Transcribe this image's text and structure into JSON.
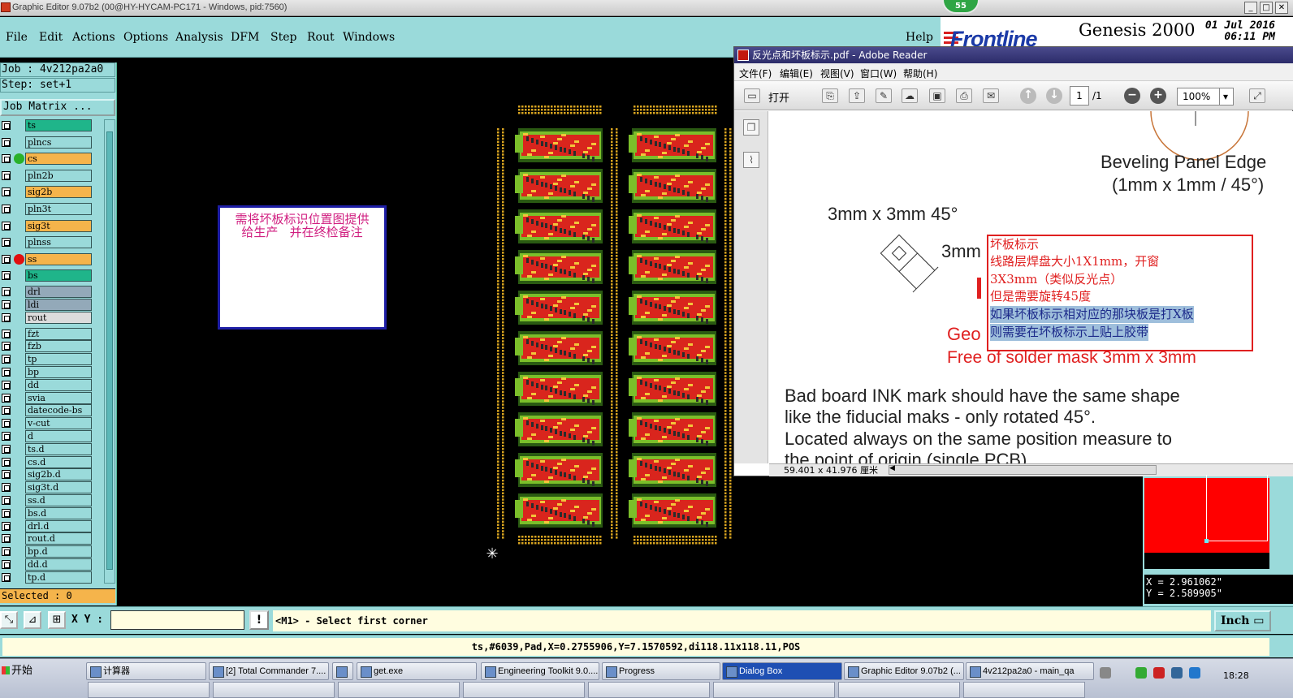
{
  "window": {
    "title": "Graphic Editor 9.07b2 (00@HY-HYCAM-PC171 - Windows, pid:7560)",
    "badge": "55",
    "min_label": "_",
    "max_label": "□",
    "close_label": "✕"
  },
  "menu": {
    "items": [
      "File",
      "Edit",
      "Actions",
      "Options",
      "Analysis",
      "DFM",
      "Step",
      "Rout",
      "Windows"
    ],
    "help": "Help"
  },
  "brand": {
    "logo": "Frontline",
    "product": "Genesis 2000",
    "date": "01 Jul 2016",
    "time": "06:11 PM"
  },
  "left": {
    "job": "Job : 4v212pa2a0",
    "step": "Step: set+1",
    "matrix": "Job Matrix ...",
    "selected": "Selected : 0",
    "layers": [
      {
        "name": "ts",
        "color": "#1fb58a",
        "dot": ""
      },
      {
        "name": "plncs",
        "color": "#9adada",
        "dot": ""
      },
      {
        "name": "cs",
        "color": "#f5b44b",
        "dot": "#29b129"
      },
      {
        "name": "pln2b",
        "color": "#9adada",
        "dot": ""
      },
      {
        "name": "sig2b",
        "color": "#f5b44b",
        "dot": ""
      },
      {
        "name": "pln3t",
        "color": "#9adada",
        "dot": ""
      },
      {
        "name": "sig3t",
        "color": "#f5b44b",
        "dot": ""
      },
      {
        "name": "plnss",
        "color": "#9adada",
        "dot": ""
      },
      {
        "name": "ss",
        "color": "#f5b44b",
        "dot": "#e01010"
      },
      {
        "name": "bs",
        "color": "#1fb58a",
        "dot": ""
      },
      {
        "name": "drl",
        "color": "#93a9b9",
        "dot": ""
      },
      {
        "name": "ldi",
        "color": "#93a9b9",
        "dot": ""
      },
      {
        "name": "rout",
        "color": "#dcdcdc",
        "dot": ""
      },
      {
        "name": "fzt",
        "color": "#9adada",
        "dot": ""
      },
      {
        "name": "fzb",
        "color": "#9adada",
        "dot": ""
      },
      {
        "name": "tp",
        "color": "#9adada",
        "dot": ""
      },
      {
        "name": "bp",
        "color": "#9adada",
        "dot": ""
      },
      {
        "name": "dd",
        "color": "#9adada",
        "dot": ""
      },
      {
        "name": "svia",
        "color": "#9adada",
        "dot": ""
      },
      {
        "name": "datecode-bs",
        "color": "#9adada",
        "dot": ""
      },
      {
        "name": "v-cut",
        "color": "#9adada",
        "dot": ""
      },
      {
        "name": "d",
        "color": "#9adada",
        "dot": ""
      },
      {
        "name": "ts.d",
        "color": "#9adada",
        "dot": ""
      },
      {
        "name": "cs.d",
        "color": "#9adada",
        "dot": ""
      },
      {
        "name": "sig2b.d",
        "color": "#9adada",
        "dot": ""
      },
      {
        "name": "sig3t.d",
        "color": "#9adada",
        "dot": ""
      },
      {
        "name": "ss.d",
        "color": "#9adada",
        "dot": ""
      },
      {
        "name": "bs.d",
        "color": "#9adada",
        "dot": ""
      },
      {
        "name": "drl.d",
        "color": "#9adada",
        "dot": ""
      },
      {
        "name": "rout.d",
        "color": "#9adada",
        "dot": ""
      },
      {
        "name": "bp.d",
        "color": "#9adada",
        "dot": ""
      },
      {
        "name": "dd.d",
        "color": "#9adada",
        "dot": ""
      },
      {
        "name": "tp.d",
        "color": "#9adada",
        "dot": ""
      }
    ]
  },
  "canvas": {
    "note": "需将坏板标识位置图提供\n给生产   并在终检备注",
    "crosshair": "✳"
  },
  "reader": {
    "title": "反光点和坏板标示.pdf - Adobe Reader",
    "menu": [
      "文件(F)",
      "编辑(E)",
      "视图(V)",
      "窗口(W)",
      "帮助(H)"
    ],
    "open": "打开",
    "page": "1",
    "page_total": "/1",
    "zoom": "100%",
    "status": "59.401 x 41.976 厘米",
    "pdf": {
      "bevel_title": "Beveling Panel Edge",
      "bevel_dims": "(1mm x 1mm / 45°)",
      "size_label": "3mm x 3mm 45°",
      "mm_label": "3mm",
      "geo": "Geo",
      "free": "Free of solder mask 3mm x 3mm",
      "body1": "Bad board INK mark should have the same shape",
      "body2": "like the fiducial maks - only rotated 45°.",
      "body3": "Located always on the same position measure to",
      "body4": "the point of origin (single PCB)"
    },
    "popup": [
      "坏板标示",
      "线路层焊盘大小1X1mm，开窗",
      "3X3mm（类似反光点）",
      "但是需要旋转45度",
      "如果坏板标示相对应的那块板是打X板",
      "则需要在坏板标示上贴上胶带"
    ]
  },
  "coords": {
    "x": "X = 2.961062\"",
    "y": "Y = 2.589905\""
  },
  "command": {
    "xy_label": "X Y :",
    "xy_value": "",
    "bang": "!",
    "message": "<M1> - Select first corner",
    "unit": "Inch"
  },
  "info": "ts,#6039,Pad,X=0.2755906,Y=7.1570592,di118.11x118.11,POS",
  "taskbar": {
    "start": "开始",
    "items": [
      {
        "label": "计算器",
        "active": false
      },
      {
        "label": "[2] Total Commander 7....",
        "active": false
      },
      {
        "label": "",
        "active": false
      },
      {
        "label": "get.exe",
        "active": false
      },
      {
        "label": "Engineering Toolkit 9.0....",
        "active": false
      },
      {
        "label": "Progress",
        "active": false
      },
      {
        "label": "Dialog Box",
        "active": true
      },
      {
        "label": "Graphic Editor 9.07b2 (...",
        "active": false
      },
      {
        "label": "4v212pa2a0 - main_qa",
        "active": false
      }
    ],
    "clock": "18:28"
  }
}
